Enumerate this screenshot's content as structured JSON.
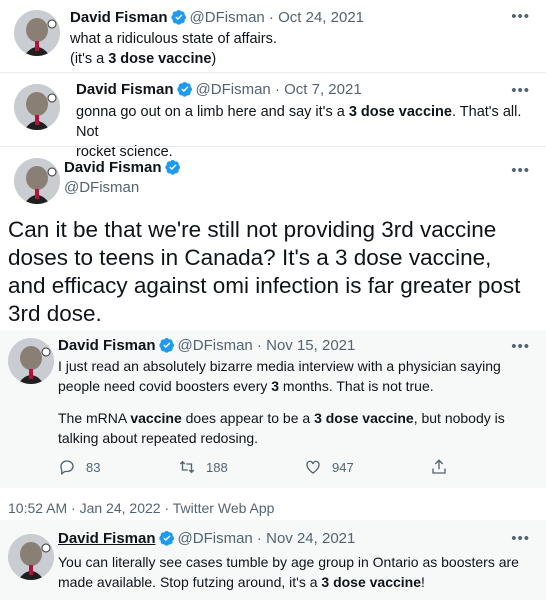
{
  "tweets": [
    {
      "name": "David Fisman",
      "handle": "@DFisman",
      "date": "Oct 24, 2021",
      "line1": "what a ridiculous state of affairs.",
      "line2a": "(it's a ",
      "line2b": "3 dose vaccine",
      "line2c": ")"
    },
    {
      "name": "David Fisman",
      "handle": "@DFisman",
      "date": "Oct 7, 2021",
      "t1": "gonna go out on a limb here and say it's a ",
      "t2": "3 dose vaccine",
      "t3": ".  That's all.  Not",
      "t4": "rocket science."
    }
  ],
  "main": {
    "name": "David Fisman",
    "handle": "@DFisman",
    "text": "Can it be that we're still not providing 3rd vaccine doses to teens in Canada?  It's a 3 dose vaccine, and efficacy against omi infection is far greater post 3rd dose.",
    "timestamp": "10:52 AM · Jan 24, 2022 · Twitter Web App"
  },
  "quoted": {
    "name": "David Fisman",
    "handle": "@DFisman",
    "date": "Nov 15, 2021",
    "p1a": "I just read an absolutely bizarre media interview with a physician saying",
    "p1b": "people need covid boosters every ",
    "p1c": "3",
    "p1d": " months.  That is not true.",
    "p2a": "The mRNA ",
    "p2b": "vaccine",
    "p2c": " does appear to be a ",
    "p2d": "3 dose vaccine",
    "p2e": ", but nobody is",
    "p2f": "talking about repeated redosing.",
    "replies": "83",
    "retweets": "188",
    "likes": "947"
  },
  "bottom": {
    "name": "David Fisman",
    "handle": "@DFisman",
    "date": "Nov 24, 2021",
    "b1": "You can literally see cases tumble by age group in Ontario as boosters are",
    "b2a": "made available.  Stop futzing around, it's a ",
    "b2b": "3 dose vaccine",
    "b2c": "!"
  },
  "more_label": "•••",
  "date_sep": " · ",
  "colors": {
    "verified": "#1d9bf0",
    "muted": "#536471",
    "text": "#0f1419"
  }
}
